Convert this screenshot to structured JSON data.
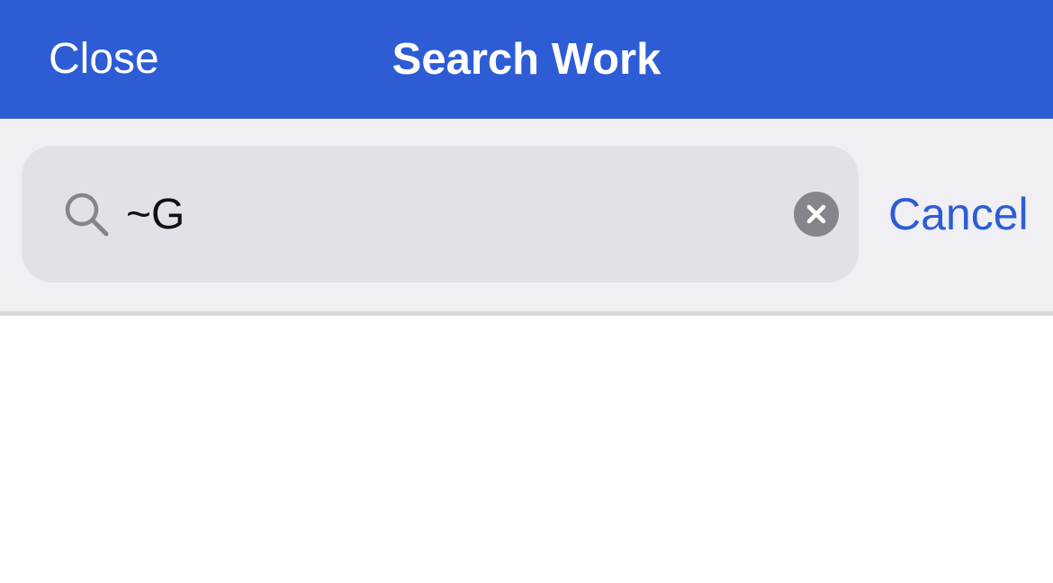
{
  "header": {
    "close_label": "Close",
    "title": "Search Work"
  },
  "search": {
    "value": "~G",
    "placeholder": "",
    "search_icon": "magnifying-glass",
    "clear_icon": "x-circle"
  },
  "cancel_label": "Cancel",
  "colors": {
    "accent": "#2d5cd5",
    "nav_background": "#2d5cd5",
    "search_area_background": "#efeff4",
    "search_field_background": "#e2e1e7",
    "clear_button": "#86858b"
  }
}
